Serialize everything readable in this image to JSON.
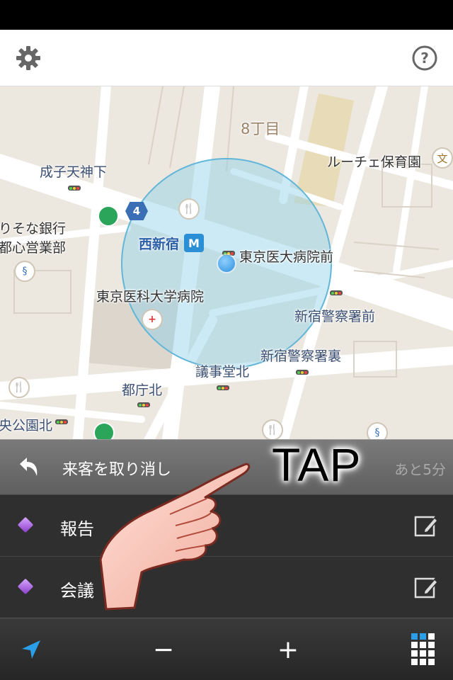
{
  "header": {
    "settings_icon": "gear-icon",
    "help_icon": "question-circle-icon"
  },
  "map": {
    "labels": {
      "block_8chome": "8丁目",
      "lucce_nursery": "ルーチェ保育園",
      "school_symbol": "文",
      "narikotenjinshita": "成子天神下",
      "resona_bank": "りそな銀行",
      "toshin_branch": "都心営業部",
      "route_number": "4",
      "nishishinjuku_station": "西新宿",
      "tokyo_med_front": "東京医大病院前",
      "tokyo_med_hospital": "東京医科大学病院",
      "shinjuku_police_front": "新宿警察署前",
      "shinjuku_police_back": "新宿警察署裏",
      "gijidokita": "議事堂北",
      "tochokita": "都庁北",
      "chuokoenkita": "央公園北"
    },
    "colors": {
      "road": "#ffffff",
      "background": "#ece7df",
      "park": "#e7dcb7",
      "accuracy_circle": "#7cc4e0",
      "location_dot": "#3a9ee0"
    }
  },
  "undo": {
    "label": "来客を取り消し",
    "remaining": "あと5分",
    "icon": "undo-arrow-icon"
  },
  "items": [
    {
      "label": "報告",
      "icon": "purple-diamond-icon",
      "edit_icon": "edit-icon"
    },
    {
      "label": "会議",
      "icon": "purple-diamond-icon",
      "edit_icon": "edit-icon"
    }
  ],
  "toolbar": {
    "location_icon": "location-arrow-icon",
    "zoom_out": "−",
    "zoom_in": "+",
    "grid_icon": "grid-menu-icon"
  },
  "overlay": {
    "tap_text": "TAP",
    "hand_icon": "pointing-hand-icon"
  }
}
